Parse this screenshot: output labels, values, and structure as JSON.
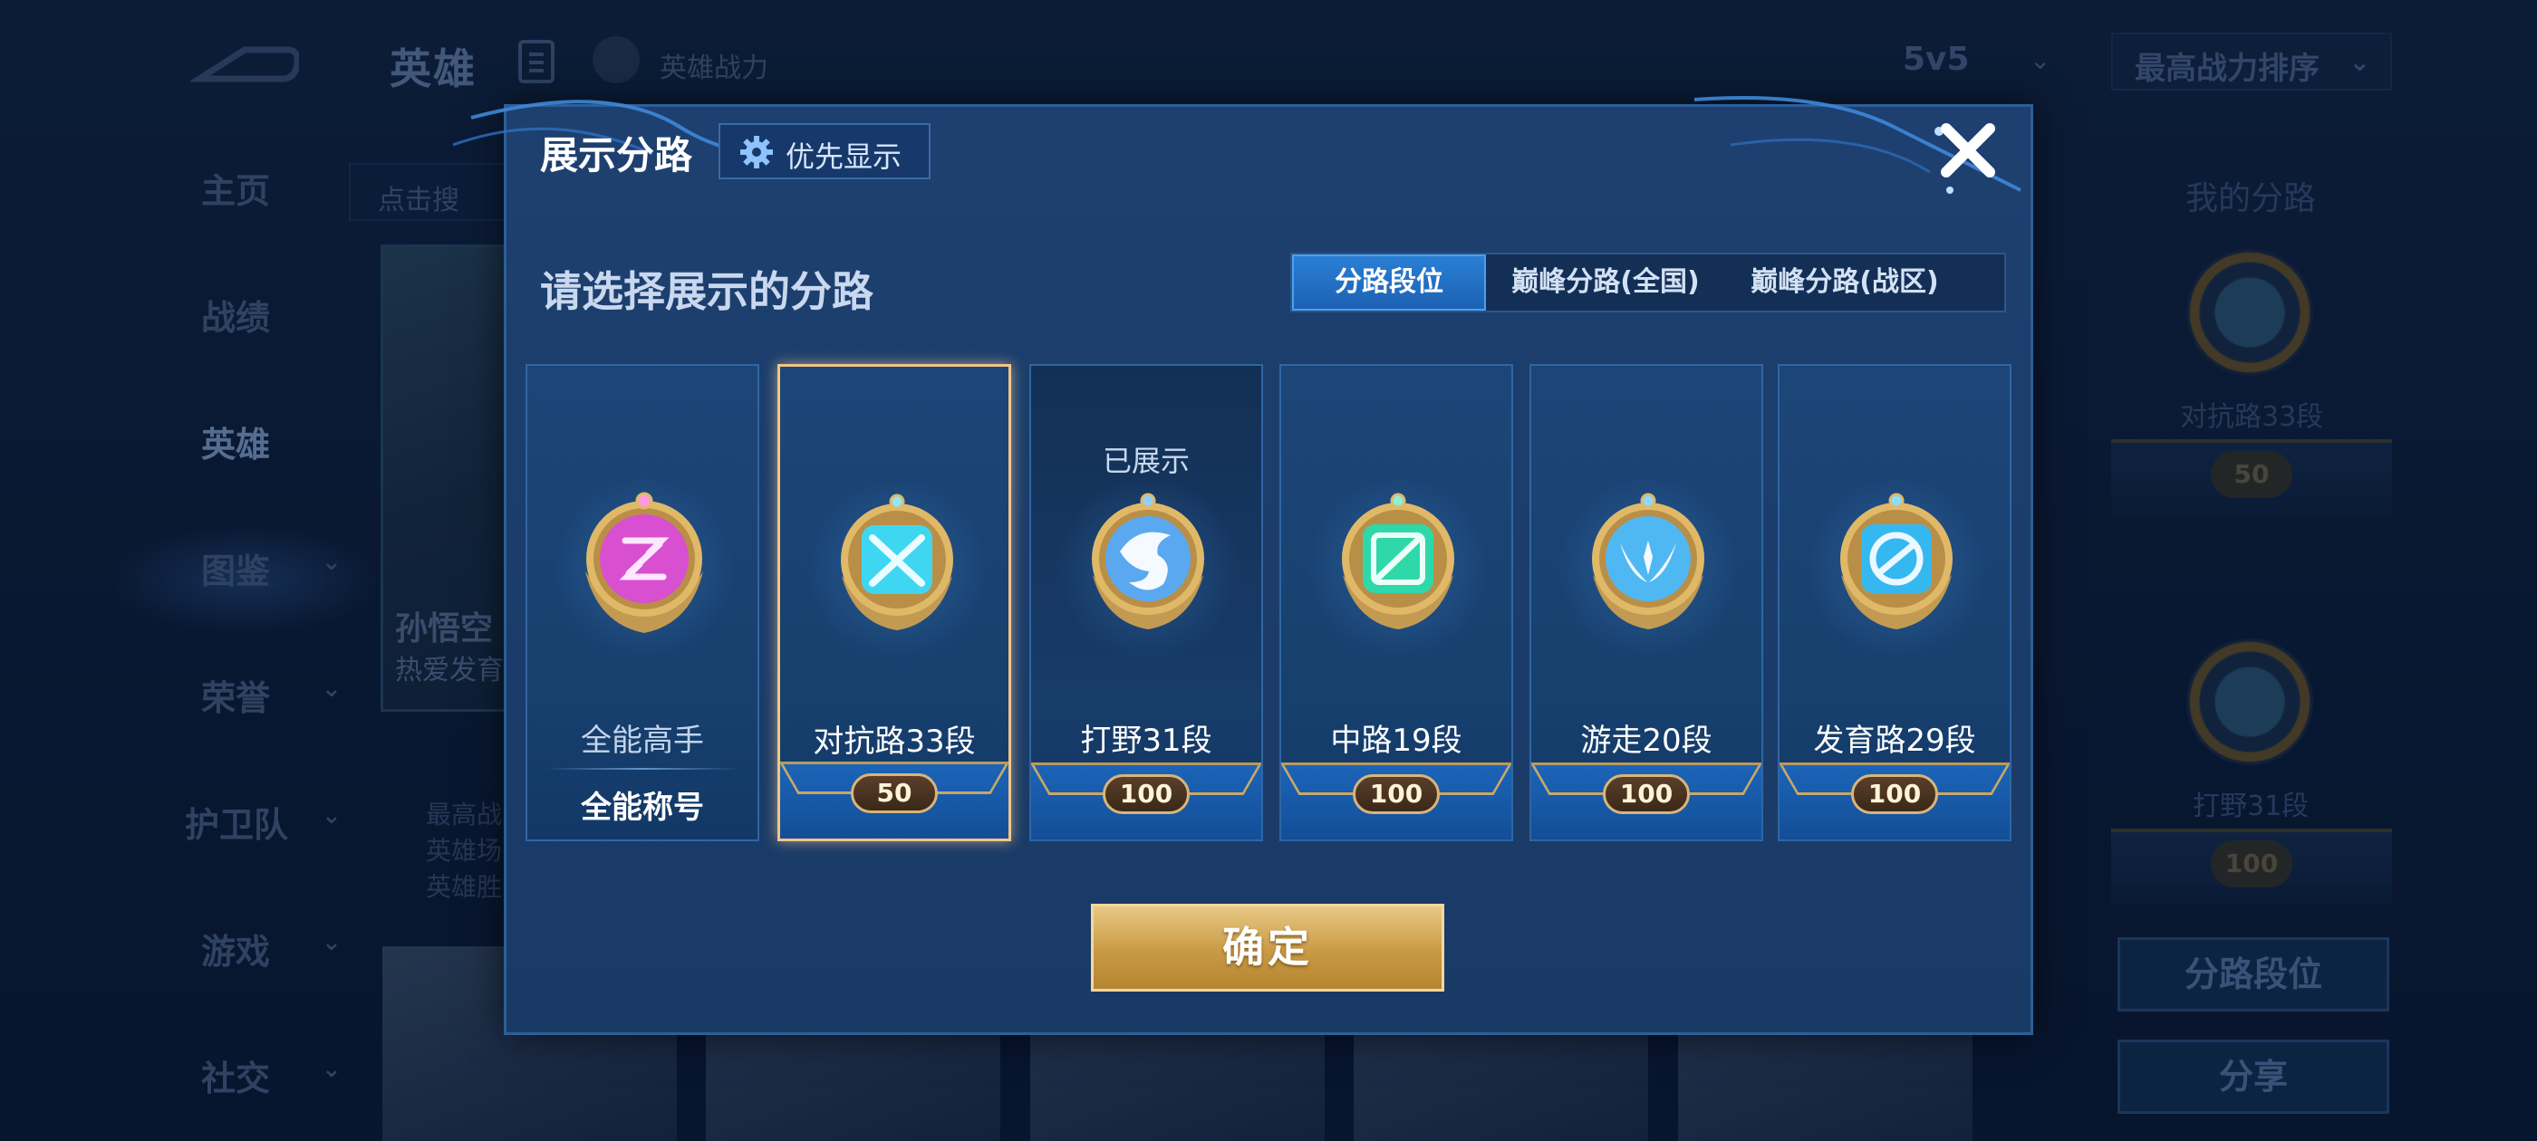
{
  "background": {
    "page_title": "英雄",
    "hero_power_label": "英雄战力",
    "mode_select": "5v5",
    "sort_select": "最高战力排序",
    "search_placeholder": "点击搜",
    "nav": [
      {
        "label": "主页",
        "has_chevron": false
      },
      {
        "label": "战绩",
        "has_chevron": false
      },
      {
        "label": "英雄",
        "has_chevron": false,
        "active": true
      },
      {
        "label": "图鉴",
        "has_chevron": true
      },
      {
        "label": "荣誉",
        "has_chevron": true
      },
      {
        "label": "护卫队",
        "has_chevron": true
      },
      {
        "label": "游戏",
        "has_chevron": true
      },
      {
        "label": "社交",
        "has_chevron": true
      }
    ],
    "featured_hero": {
      "name": "孙悟空",
      "subtitle": "热爱发育",
      "stats": [
        "最高战",
        "英雄场",
        "英雄胜"
      ]
    },
    "right_panel": {
      "title": "我的分路",
      "lane1_label": "对抗路33段",
      "lane1_num": "50",
      "lane2_label": "打野31段",
      "lane2_num": "100",
      "lane_rank_button": "分路段位",
      "share_button": "分享"
    }
  },
  "modal": {
    "title": "展示分路",
    "preference_button": "优先显示",
    "subtitle": "请选择展示的分路",
    "tabs": [
      {
        "label": "分路段位",
        "active": true
      },
      {
        "label": "巅峰分路(全国)",
        "active": false
      },
      {
        "label": "巅峰分路(战区)",
        "active": false
      }
    ],
    "cards": [
      {
        "label": "全能高手",
        "footer": "全能称号",
        "icon": "generalist-badge-icon",
        "color": "#d84fd0",
        "selected": false,
        "shown": false
      },
      {
        "label": "对抗路33段",
        "number": "50",
        "icon": "clash-lane-badge-icon",
        "color": "#3fd6f2",
        "selected": true,
        "shown": false
      },
      {
        "label": "打野31段",
        "number": "100",
        "icon": "jungle-badge-icon",
        "color": "#5aa8f0",
        "selected": false,
        "shown": true,
        "shown_tag": "已展示"
      },
      {
        "label": "中路19段",
        "number": "100",
        "icon": "mid-lane-badge-icon",
        "color": "#2fd8a8",
        "selected": false,
        "shown": false
      },
      {
        "label": "游走20段",
        "number": "100",
        "icon": "roam-badge-icon",
        "color": "#4fb8f2",
        "selected": false,
        "shown": false
      },
      {
        "label": "发育路29段",
        "number": "100",
        "icon": "farm-lane-badge-icon",
        "color": "#35b8f0",
        "selected": false,
        "shown": false
      }
    ],
    "confirm_button": "确定"
  }
}
